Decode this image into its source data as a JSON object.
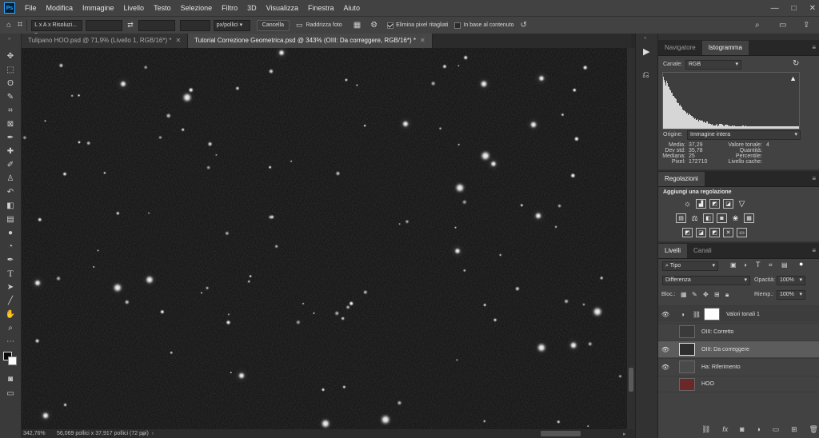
{
  "app": {
    "logo": "Ps"
  },
  "menu": [
    "File",
    "Modifica",
    "Immagine",
    "Livello",
    "Testo",
    "Selezione",
    "Filtro",
    "3D",
    "Visualizza",
    "Finestra",
    "Aiuto"
  ],
  "window_controls": {
    "minimize": "—",
    "maximize": "□",
    "close": "✕"
  },
  "options_bar": {
    "ratio_select": "L x A x Risoluzi...",
    "width_value": "",
    "height_value": "",
    "resolution_value": "",
    "units_select": "px/pollici",
    "cancel_label": "Cancella",
    "straighten_label": "Raddrizza foto",
    "delete_cropped_label": "Elimina pixel ritagliati",
    "delete_cropped_checked": true,
    "content_aware_label": "In base al contenuto",
    "content_aware_checked": false
  },
  "doc_tabs": [
    {
      "label": "Tulipano HOO.psd @ 71,9% (Livello 1, RGB/16*) *",
      "active": false
    },
    {
      "label": "Tutorial Correzione Geometrica.psd @ 343% (OIII: Da correggere, RGB/16*) *",
      "active": true
    }
  ],
  "tools": [
    "move-icon",
    "marquee-icon",
    "lasso-icon",
    "quick-select-icon",
    "crop-icon",
    "frame-icon",
    "eyedropper-icon",
    "healing-icon",
    "brush-icon",
    "stamp-icon",
    "history-brush-icon",
    "eraser-icon",
    "gradient-icon",
    "blur-icon",
    "dodge-icon",
    "pen-icon",
    "type-icon",
    "path-select-icon",
    "line-icon",
    "hand-icon",
    "zoom-icon",
    "more-icon"
  ],
  "status": {
    "zoom": "342,76%",
    "doc_info": "56,069 pollici x 37,917 pollici (72 ppi)"
  },
  "histogram_panel": {
    "tabs": [
      "Navigatore",
      "Istogramma"
    ],
    "active_tab": "Istogramma",
    "channel_label": "Canale:",
    "channel_value": "RGB",
    "source_label": "Origine:",
    "source_value": "Immagine intera",
    "stats_left": [
      {
        "label": "Media:",
        "value": "37,29"
      },
      {
        "label": "Dev std:",
        "value": "35,78"
      },
      {
        "label": "Mediana:",
        "value": "25"
      },
      {
        "label": "Pixel:",
        "value": "172710"
      }
    ],
    "stats_right": [
      {
        "label": "Valore tonale:",
        "value": ""
      },
      {
        "label": "Quantità:",
        "value": ""
      },
      {
        "label": "Percentile:",
        "value": ""
      },
      {
        "label": "Livello cache:",
        "value": "4"
      }
    ]
  },
  "adjustments_panel": {
    "tab": "Regolazioni",
    "heading": "Aggiungi una regolazione"
  },
  "layers_panel": {
    "tabs": [
      "Livelli",
      "Canali"
    ],
    "active_tab": "Livelli",
    "filter_value": "Tipo",
    "blend_mode": "Differenza",
    "opacity_label": "Opacità:",
    "opacity_value": "100%",
    "lock_label": "Bloc.:",
    "fill_label": "Riemp.:",
    "fill_value": "100%",
    "layers": [
      {
        "name": "Valori tonali 1",
        "visible": true,
        "selected": false,
        "kind": "adjustment"
      },
      {
        "name": "OIII: Corretto",
        "visible": false,
        "selected": false,
        "kind": "image"
      },
      {
        "name": "OIII: Da correggere",
        "visible": true,
        "selected": true,
        "kind": "image"
      },
      {
        "name": "Ha: Riferimento",
        "visible": true,
        "selected": false,
        "kind": "image"
      },
      {
        "name": "HOO",
        "visible": false,
        "selected": false,
        "kind": "color"
      }
    ]
  },
  "colors": {
    "accent": "#31a8ff",
    "panel": "#424242",
    "chrome": "#323232"
  }
}
